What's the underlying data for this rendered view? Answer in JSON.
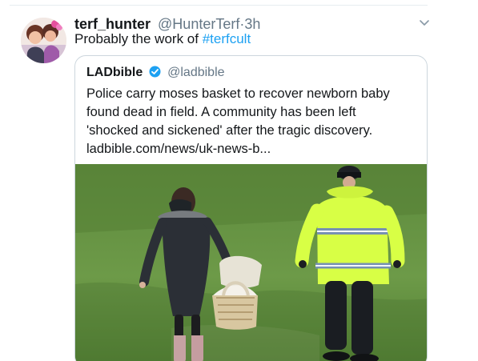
{
  "tweet": {
    "display_name": "terf_hunter",
    "handle": "@HunterTerf",
    "separator": "·",
    "time": "3h",
    "text_prefix": "Probably the work of ",
    "hashtag": "#terfcult"
  },
  "quoted_tweet": {
    "display_name": "LADbible",
    "handle": "@ladbible",
    "text_lines": [
      "Police carry moses basket to recover newborn baby",
      "found dead in field. A community has been left",
      "'shocked and sickened' after the tragic discovery.",
      "ladbible.com/news/uk-news-b..."
    ]
  },
  "colors": {
    "text_primary": "#14171a",
    "text_secondary": "#657786",
    "link": "#1da1f2",
    "border": "#ccd6dd",
    "verified_badge": "#1da1f2"
  },
  "icons": {
    "menu": "chevron-down-icon",
    "verified": "verified-badge-icon"
  }
}
